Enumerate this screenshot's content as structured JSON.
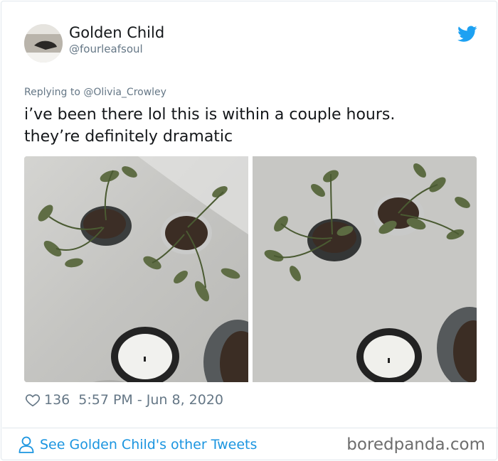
{
  "author": {
    "name": "Golden Child",
    "handle": "@fourleafsoul",
    "avatar_icon": "avatar-photo"
  },
  "reply": {
    "text": "Replying to @Olivia_Crowley"
  },
  "tweet": {
    "text_line1": "i’ve been there lol this is within a couple hours.",
    "text_line2": "they’re definitely dramatic"
  },
  "media": [
    {
      "icon": "photo-wilted-plants"
    },
    {
      "icon": "photo-recovered-plants"
    }
  ],
  "meta": {
    "likes": "136",
    "timestamp": "5:57 PM - Jun 8, 2020"
  },
  "footer": {
    "see_more": "See Golden Child's other Tweets",
    "watermark": "boredpanda.com"
  },
  "colors": {
    "link": "#1b95e0",
    "muted": "#657786",
    "twitter_blue": "#1da1f2"
  }
}
